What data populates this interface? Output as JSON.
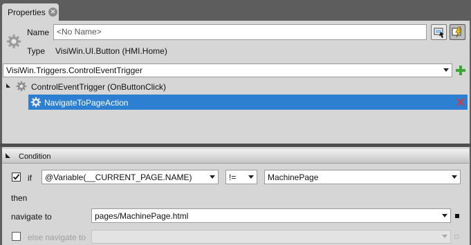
{
  "tab": {
    "title": "Properties"
  },
  "properties": {
    "name_label": "Name",
    "name_placeholder": "<No Name>",
    "type_label": "Type",
    "type_value": "VisiWin.UI.Button (HMI.Home)"
  },
  "trigger_select": {
    "value": "VisiWin.Triggers.ControlEventTrigger"
  },
  "tree": {
    "parent_label": "ControlEventTrigger (OnButtonClick)",
    "child_label": "NavigateToPageAction"
  },
  "condition": {
    "header": "Condition",
    "if_label": "if",
    "variable_value": "@Variable(__CURRENT_PAGE.NAME)",
    "operator_value": "!=",
    "compare_value": "MachinePage",
    "then_label": "then",
    "navigate_label": "navigate to",
    "navigate_value": "pages/MachinePage.html",
    "else_label": "else navigate to",
    "else_value": ""
  },
  "colors": {
    "selection": "#2d7fd1",
    "add_icon": "#3aa832",
    "delete_icon": "#d43a3a",
    "panel_bg": "#d6d6d6"
  },
  "icons": [
    "close-icon",
    "gear-icon",
    "plus-icon",
    "delete-icon",
    "properties-view-icon",
    "events-view-icon",
    "expand-arrow-icon",
    "dropdown-arrow-icon"
  ]
}
